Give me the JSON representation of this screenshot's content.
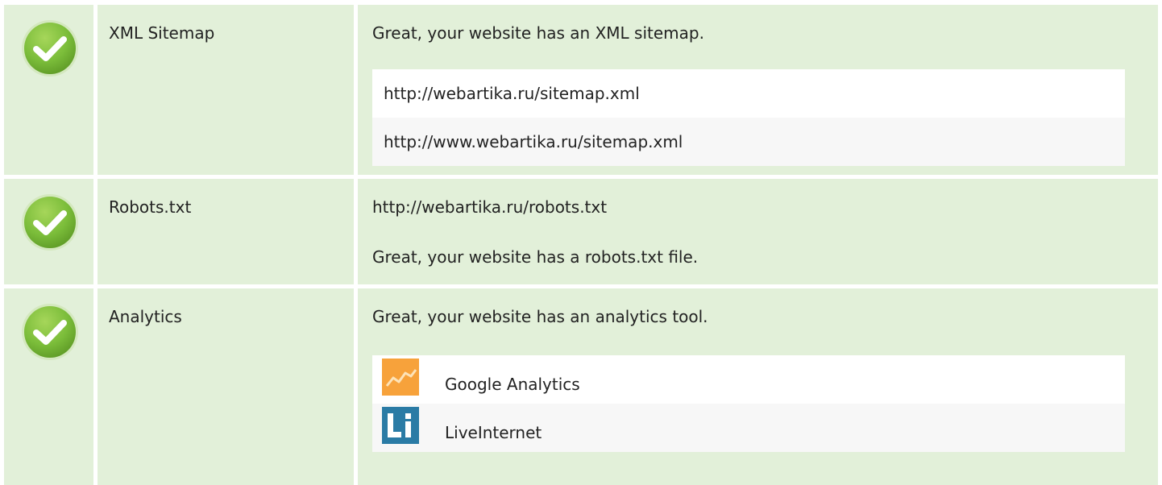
{
  "colors": {
    "row_background": "#e2f0d9",
    "list_odd": "#ffffff",
    "list_even": "#f7f7f7",
    "check_green": "#7bbd3a",
    "google_analytics_orange": "#f7a23b",
    "liveinternet_blue": "#2a7ba5"
  },
  "rows": [
    {
      "icon": "check-circle-icon",
      "label": "XML Sitemap",
      "message": "Great, your website has an XML sitemap.",
      "items": [
        "http://webartika.ru/sitemap.xml",
        "http://www.webartika.ru/sitemap.xml"
      ]
    },
    {
      "icon": "check-circle-icon",
      "label": "Robots.txt",
      "url": "http://webartika.ru/robots.txt",
      "message": "Great, your website has a robots.txt file."
    },
    {
      "icon": "check-circle-icon",
      "label": "Analytics",
      "message": "Great, your website has an analytics tool.",
      "tools": [
        {
          "name": "Google Analytics",
          "icon": "google-analytics-icon"
        },
        {
          "name": "LiveInternet",
          "icon": "liveinternet-icon"
        }
      ]
    }
  ]
}
